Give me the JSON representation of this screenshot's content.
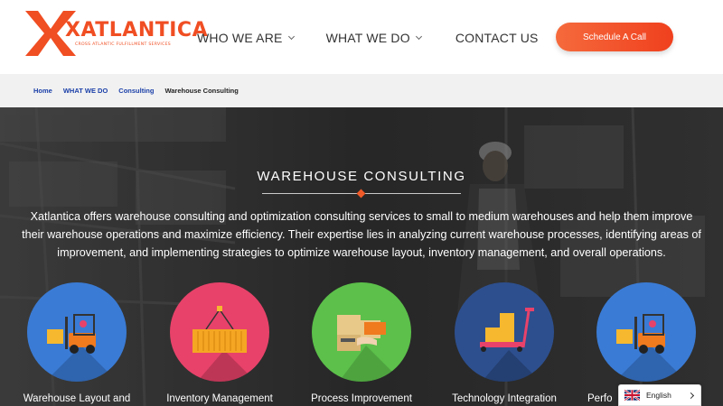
{
  "header": {
    "logo_text": "XATLANTICA",
    "logo_tagline": "CROSS ATLANTIC FULFILLMENT SERVICES",
    "nav": [
      {
        "label": "WHO WE ARE"
      },
      {
        "label": "WHAT WE DO"
      },
      {
        "label": "CONTACT US"
      }
    ],
    "cta_label": "Schedule A Call"
  },
  "breadcrumb": {
    "items": [
      "Home",
      "WHAT WE DO",
      "Consulting"
    ],
    "current": "Warehouse Consulting"
  },
  "hero": {
    "title": "WAREHOUSE CONSULTING",
    "description": "Xatlantica offers warehouse consulting and optimization consulting services to small to medium warehouses and help them improve their warehouse operations and maximize efficiency. Their expertise lies in analyzing current warehouse processes, identifying areas of improvement, and implementing strategies to optimize warehouse layout, inventory management, and overall operations."
  },
  "services": [
    {
      "label": "Warehouse Layout and",
      "icon": "forklift-icon",
      "color": "#3a7bd5"
    },
    {
      "label": "Inventory Management",
      "icon": "container-icon",
      "color": "#e8426a"
    },
    {
      "label": "Process Improvement",
      "icon": "boxes-icon",
      "color": "#5cc04a"
    },
    {
      "label": "Technology Integration",
      "icon": "pallet-jack-icon",
      "color": "#2d4f8e"
    },
    {
      "label": "Perfo",
      "icon": "forklift-icon",
      "color": "#3a7bd5"
    }
  ],
  "language": {
    "label": "English"
  },
  "colors": {
    "brand": "#f04e23",
    "link": "#1a3fa8"
  }
}
